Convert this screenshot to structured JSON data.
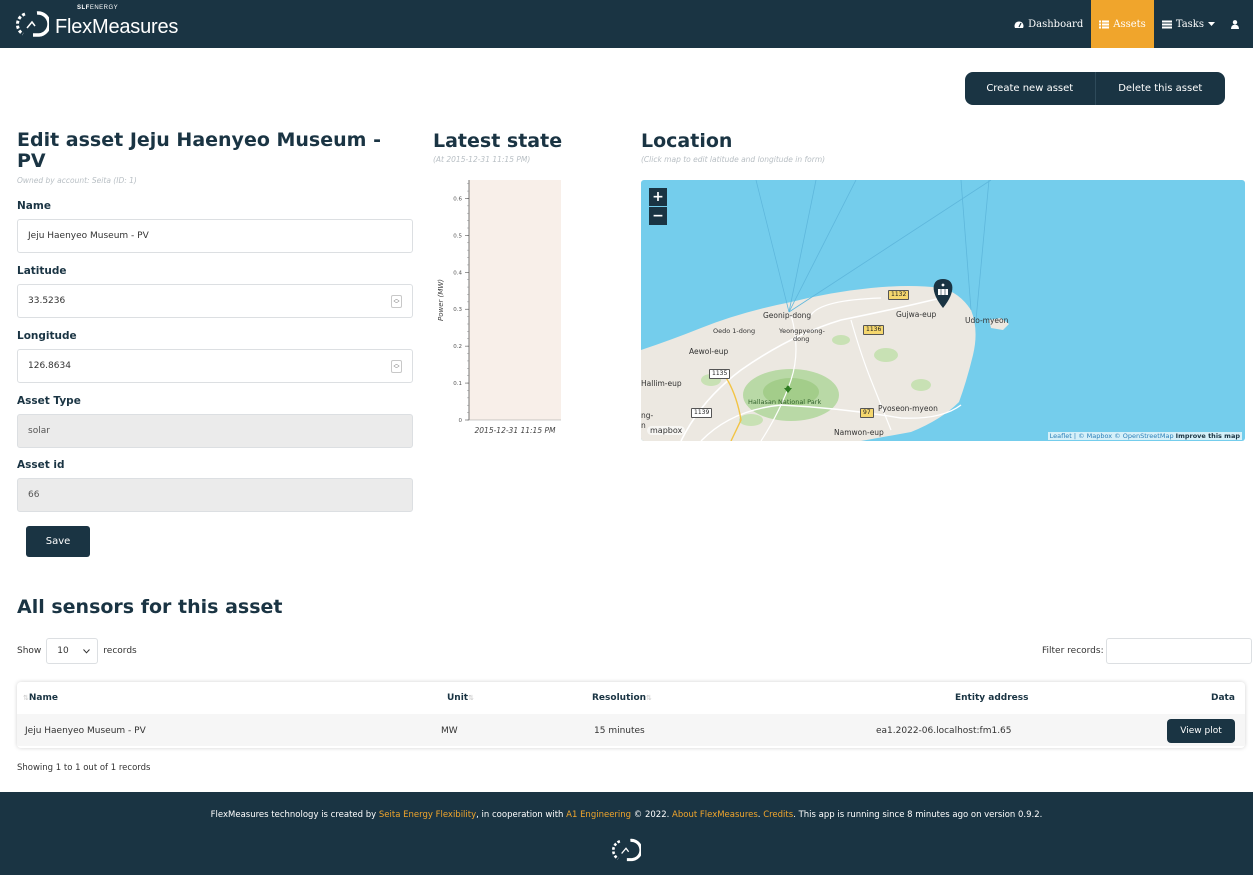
{
  "navbar": {
    "brand_name": "FlexMeasures",
    "brand_sup_bold": "SLF",
    "brand_sup_thin": "ENERGY",
    "items": [
      {
        "label": "Dashboard",
        "icon": "dashboard-icon"
      },
      {
        "label": "Assets",
        "icon": "list-icon",
        "active": true
      },
      {
        "label": "Tasks",
        "icon": "tasks-icon"
      }
    ],
    "user_icon": "user-icon",
    "accent_color": "#f0a52c",
    "bar_color": "#1a3443"
  },
  "actions": {
    "create_label": "Create new asset",
    "delete_label": "Delete this asset"
  },
  "edit_form": {
    "title": "Edit asset Jeju Haenyeo Museum - PV",
    "owner_note": "Owned by account: Seita (ID: 1)",
    "fields": {
      "name_label": "Name",
      "name_value": "Jeju Haenyeo Museum - PV",
      "latitude_label": "Latitude",
      "latitude_value": "33.5236",
      "longitude_label": "Longitude",
      "longitude_value": "126.8634",
      "asset_type_label": "Asset Type",
      "asset_type_value": "solar",
      "asset_id_label": "Asset id",
      "asset_id_value": "66"
    },
    "save_label": "Save"
  },
  "latest_state": {
    "title": "Latest state",
    "subtitle": "(At 2015-12-31 11:15 PM)"
  },
  "chart_data": {
    "type": "bar",
    "categories": [
      "2015-12-31 11:15 PM"
    ],
    "values": [
      0
    ],
    "ylabel": "Power (MW)",
    "xlabel": "",
    "ylim": [
      0,
      0.65
    ],
    "yticks": [
      "0",
      "0.1",
      "0.2",
      "0.3",
      "0.4",
      "0.5",
      "0.6"
    ],
    "grid": false
  },
  "location": {
    "title": "Location",
    "subtitle": "(Click map to edit latitude and longitude in form)",
    "zoom_in": "+",
    "zoom_out": "−",
    "labels": {
      "geonip": "Geonip-dong",
      "gujwa": "Gujwa-eup",
      "udo": "Udo-myeon",
      "oedo": "Oedo 1-dong",
      "yeongpyeong": "Yeongpyeong-",
      "yeongpyeong2": "dong",
      "aewol": "Aewol-eup",
      "hallim": "Hallim-eup",
      "hallasan": "Hallasan National Park",
      "pyoseon": "Pyoseon-myeon",
      "namwon": "Namwon-eup",
      "ng": "ng-",
      "n": "n"
    },
    "roads": [
      "1132",
      "1136",
      "1135",
      "1139",
      "97"
    ],
    "mapbox_logo": "mapbox",
    "attribution_prefix": "Leaflet | © Mapbox © OpenStreetMap",
    "attribution_improve": "Improve this map",
    "marker_icon": "solar-panel-marker-icon",
    "water_color": "#74cdec",
    "land_color": "#ece8e1"
  },
  "sensors": {
    "title": "All sensors for this asset",
    "show_label": "Show",
    "show_value": "10",
    "records_label": "records",
    "filter_label": "Filter records:",
    "columns": [
      "Name",
      "Unit",
      "Resolution",
      "Entity address",
      "Data"
    ],
    "rows": [
      {
        "name": "Jeju Haenyeo Museum - PV",
        "unit": "MW",
        "resolution": "15 minutes",
        "entity_address": "ea1.2022-06.localhost:fm1.65",
        "action_label": "View plot"
      }
    ],
    "summary": "Showing 1 to 1 out of 1 records"
  },
  "footer": {
    "t1": "FlexMeasures technology is created by ",
    "l1": "Seita Energy Flexibility",
    "t2": ", in cooperation with ",
    "l2": "A1 Engineering",
    "t3": " © 2022. ",
    "l3": "About FlexMeasures",
    "t4": ". ",
    "l4": "Credits",
    "t5": ". This app is running since 8 minutes ago on version 0.9.2."
  }
}
